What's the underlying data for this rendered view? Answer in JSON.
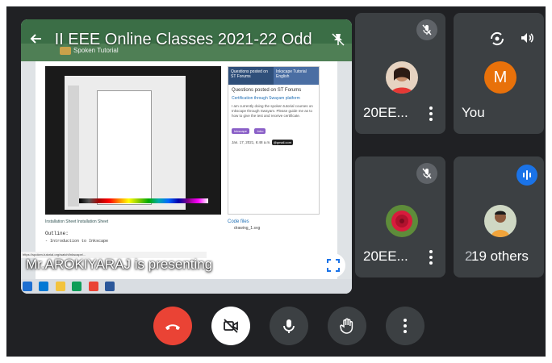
{
  "meeting": {
    "title": "II EEE Online Classes 2021-22 Odd",
    "presenter_banner": "Mr.AROKIYARAJ is presenting"
  },
  "shared_screen": {
    "site_name": "Spoken Tutorial",
    "forum_tabs": [
      "Questions posted on ST Forums",
      "Inkscape Tutorial English"
    ],
    "forum_heading": "Questions posted on ST Forums",
    "forum_question_title": "Certification through Swayam platform",
    "forum_question_body": "I am currently doing the spoken tutorial courses on Inkscape through Swayam. Please guide me as to how to give the test and receive certificate.",
    "forum_tags": [
      "Inkscape",
      "Intro"
    ],
    "forum_date": "Jan. 17, 2021, 6:48 a.m.",
    "forum_email": "@gmail.com",
    "links": "Installation Sheet   Installation Sheet",
    "outline_heading": "Outline:",
    "outline_item": "- Introduction to Inkscape",
    "code_files_heading": "Code files",
    "code_file_item": "drawing_1.svg",
    "status_url": "https://spoken-tutorial.org/watch/Inkscape/..."
  },
  "participants": [
    {
      "name": "20EE...",
      "muted": true
    },
    {
      "name": "You",
      "initial": "M"
    },
    {
      "name": "20EE...",
      "muted": true
    },
    {
      "name": "19 others",
      "behind_label": "2"
    }
  ],
  "colors": {
    "background": "#202124",
    "tile": "#3c4043",
    "hangup": "#ea4335",
    "speaking": "#1a73e8",
    "avatar_you": "#e8710a"
  },
  "icons": {
    "back": "arrow-left-icon",
    "pin": "pin-off-icon",
    "fullscreen": "fullscreen-icon",
    "mic_off": "mic-off-icon",
    "switch_camera": "switch-camera-icon",
    "speaker": "volume-icon",
    "speaking": "audio-level-icon",
    "hangup": "call-end-icon",
    "camera_off": "camera-off-icon",
    "mic": "mic-icon",
    "raise_hand": "raise-hand-icon",
    "more": "more-vert-icon"
  }
}
